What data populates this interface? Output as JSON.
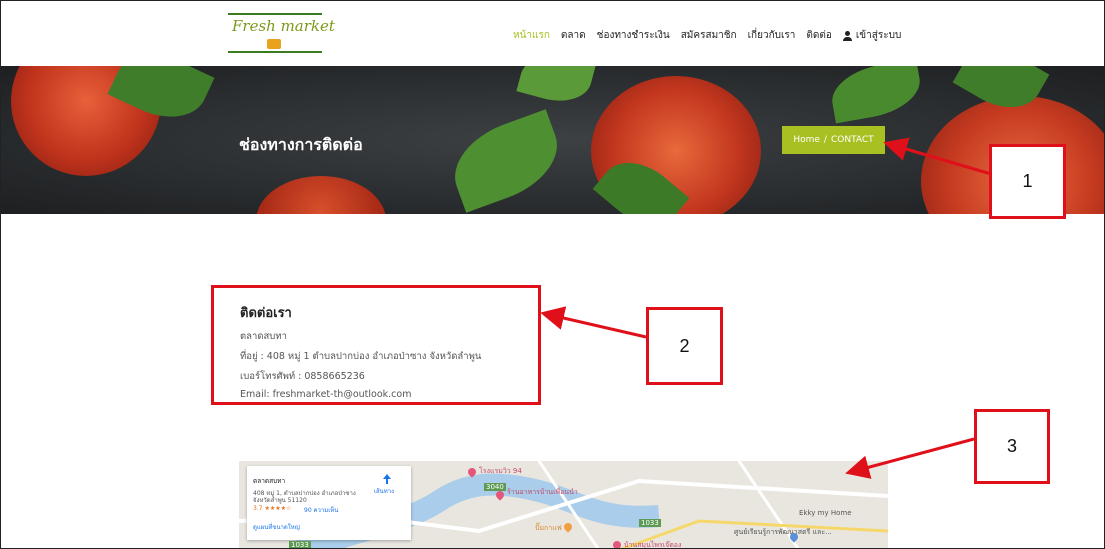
{
  "header": {
    "logo_text": "Fresh market",
    "nav": [
      "หน้าแรก",
      "ตลาด",
      "ช่องทางชำระเงิน",
      "สมัครสมาชิก",
      "เกี่ยวกับเรา",
      "ติดต่อ"
    ],
    "login_label": "เข้าสู่ระบบ",
    "accent_color": "#a8c022"
  },
  "hero": {
    "title": "ช่องทางการติดต่อ",
    "breadcrumb_home": "Home",
    "breadcrumb_sep": "/",
    "breadcrumb_current": "CONTACT"
  },
  "contact": {
    "title": "ติดต่อเรา",
    "name": "ตลาดสบทา",
    "address": "ที่อยู่ : 408 หมู่ 1 ตำบลปากบ่อง อำเภอป่าซาง จังหวัดลำพูน",
    "phone": "เบอร์โทรศัพท์ : 0858665236",
    "email": "Email: freshmarket-th@outlook.com"
  },
  "map": {
    "place_name": "ตลาดสบทา",
    "address_line1": "408 หมู่ 1, ตำบลปากบ่อง อำเภอป่าซาง",
    "address_line2": "จังหวัดลำพูน 51120",
    "rating": "3.7 ★★★★☆",
    "reviews": "90 ความเห็น",
    "directions": "เส้นทาง",
    "larger_map": "ดูแผนที่ขนาดใหญ่",
    "labels": [
      "โรงแรมวิว 94",
      "ร้านอาหารบ้านเพื่อนนำ",
      "ปั๊มกาแฟ",
      "Ekky my Home",
      "ศูนย์เรียนรู้การพัฒนาสตรี และ...",
      "บ้านสมุนไพรเจ๊ดอง",
      "3040",
      "1033",
      "1033"
    ]
  },
  "annotations": [
    "1",
    "2",
    "3"
  ]
}
